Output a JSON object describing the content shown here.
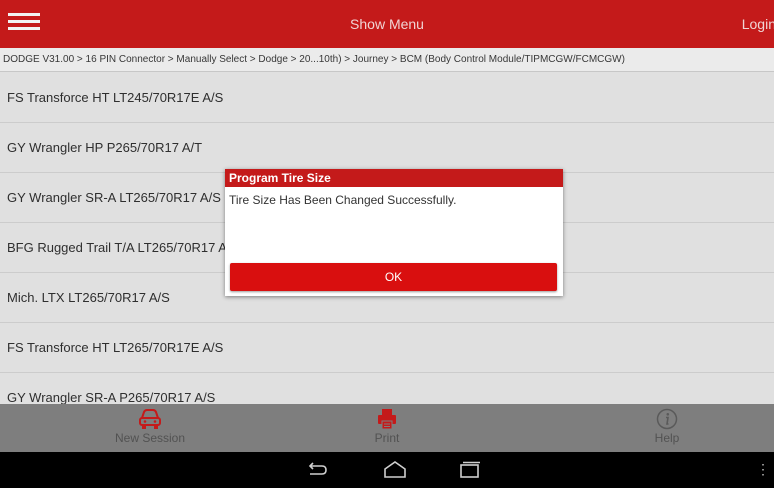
{
  "header": {
    "title": "Show Menu",
    "login_label": "Login"
  },
  "breadcrumb": "DODGE V31.00 > 16 PIN Connector > Manually Select > Dodge > 20...10th) > Journey > BCM (Body Control Module/TIPMCGW/FCMCGW)",
  "tire_list": [
    "FS Transforce HT LT245/70R17E A/S",
    "GY Wrangler HP P265/70R17 A/T",
    "GY Wrangler SR-A LT265/70R17 A/S",
    "BFG Rugged Trail T/A LT265/70R17 A/S",
    "Mich. LTX LT265/70R17 A/S",
    "FS Transforce HT LT265/70R17E A/S",
    "GY Wrangler SR-A P265/70R17 A/S"
  ],
  "dialog": {
    "title": "Program Tire Size",
    "message": "Tire Size Has Been Changed Successfully.",
    "ok_label": "OK"
  },
  "bottom_bar": {
    "new_session_label": "New Session",
    "print_label": "Print",
    "help_label": "Help"
  },
  "icons": {
    "menu": "hamburger-icon",
    "new_session": "car-icon",
    "print": "printer-icon",
    "help": "info-icon",
    "back": "back-icon",
    "home": "home-icon",
    "recents": "recents-icon"
  },
  "colors": {
    "accent": "#c41a1a",
    "button": "#d90f0f",
    "bottom_bar": "#7e7e7e"
  }
}
